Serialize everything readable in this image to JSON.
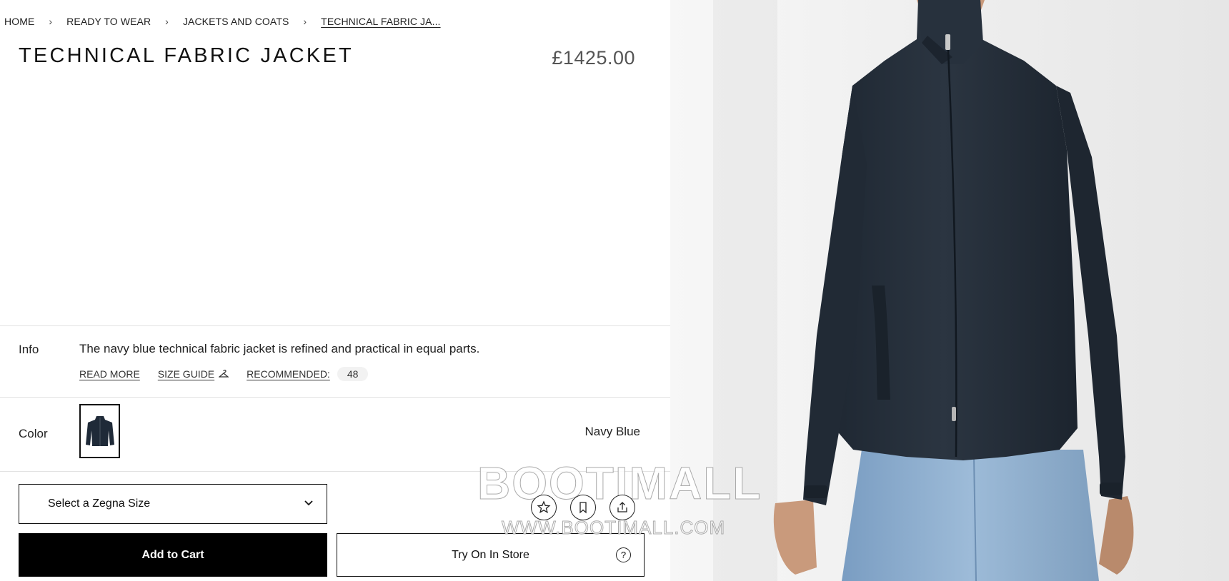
{
  "breadcrumb": {
    "items": [
      "HOME",
      "READY TO WEAR",
      "JACKETS AND COATS",
      "TECHNICAL FABRIC JA..."
    ],
    "separator": "›"
  },
  "product": {
    "title": "TECHNICAL FABRIC JACKET",
    "price": "£1425.00"
  },
  "info": {
    "label": "Info",
    "description": "The navy blue technical fabric jacket is refined and practical in equal parts.",
    "read_more": "READ MORE",
    "size_guide": "SIZE GUIDE",
    "recommended_label": "RECOMMENDED:",
    "recommended_size": "48"
  },
  "color": {
    "label": "Color",
    "value": "Navy Blue",
    "swatch_color": "#1f2a38"
  },
  "size_select": {
    "placeholder": "Select a Zegna Size"
  },
  "actions": {
    "add_to_cart": "Add to Cart",
    "try_on_store": "Try On In Store",
    "help": "?"
  },
  "watermark": {
    "brand": "BOOTIMALL",
    "url": "WWW.BOOTIMALL.COM"
  },
  "colors": {
    "jacket": "#27313d",
    "jeans": "#8fb0d2",
    "skin": "#c99a7c",
    "background": "#efefef"
  }
}
